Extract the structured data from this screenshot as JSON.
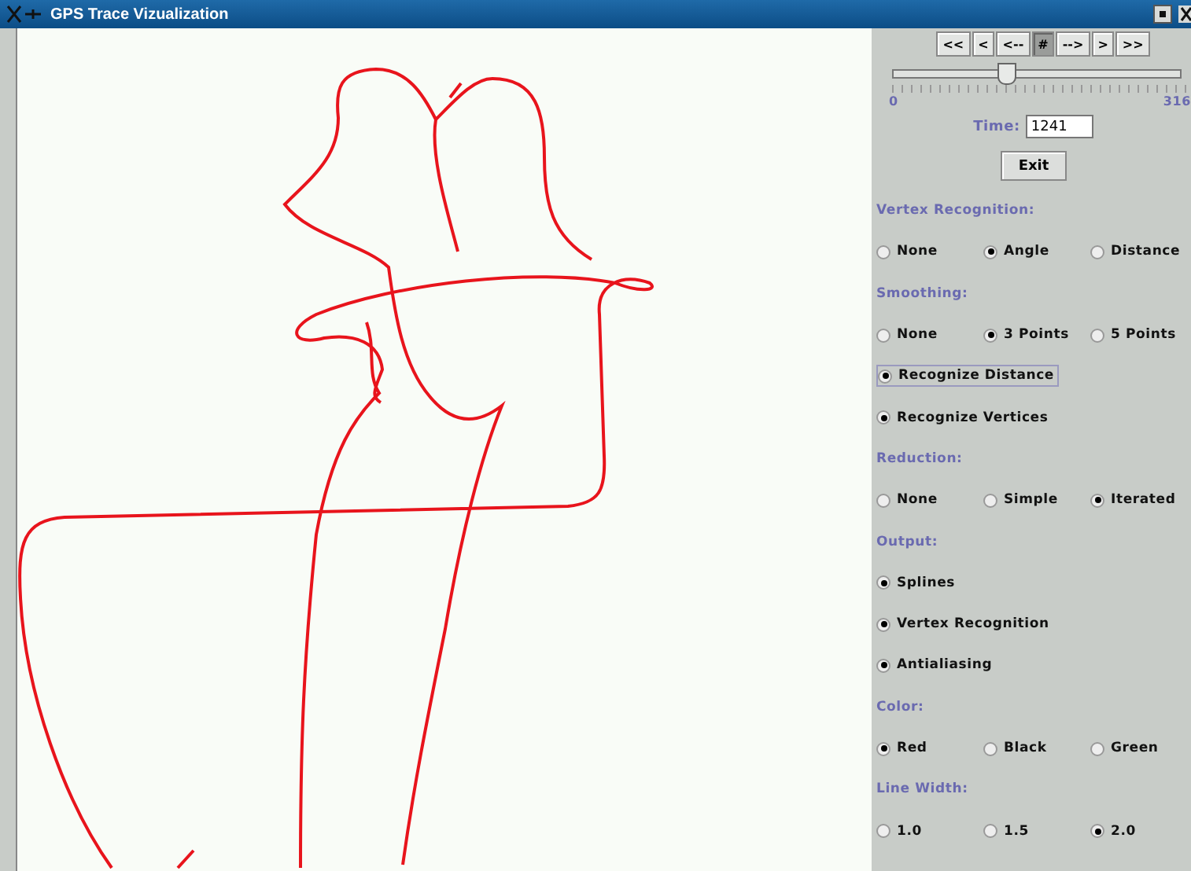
{
  "window": {
    "title": "GPS Trace Vizualization"
  },
  "nav_buttons": [
    {
      "label": "<<",
      "selected": false
    },
    {
      "label": "<",
      "selected": false
    },
    {
      "label": "<--",
      "selected": false
    },
    {
      "label": "#",
      "selected": true
    },
    {
      "label": "-->",
      "selected": false
    },
    {
      "label": ">",
      "selected": false
    },
    {
      "label": ">>",
      "selected": false
    }
  ],
  "time_slider": {
    "level": 0.39,
    "min_label": "0",
    "max_label": "316"
  },
  "time_field": {
    "label": "Time:",
    "value": "1241"
  },
  "exit_button": {
    "label": "Exit"
  },
  "sections": [
    {
      "title": "Vertex Recognition:",
      "rows": [
        {
          "kind": "choice",
          "options": [
            {
              "label": "None",
              "selected": false
            },
            {
              "label": "Angle",
              "selected": true
            },
            {
              "label": "Distance",
              "selected": false
            }
          ]
        }
      ]
    },
    {
      "title": "Smoothing:",
      "rows": [
        {
          "kind": "choice",
          "options": [
            {
              "label": "None",
              "selected": false
            },
            {
              "label": "3 Points",
              "selected": true
            },
            {
              "label": "5 Points",
              "selected": false
            }
          ]
        },
        {
          "kind": "toggle",
          "label": "Recognize Distance",
          "checked": true,
          "focused": true
        },
        {
          "kind": "toggle",
          "label": "Recognize Vertices",
          "checked": true,
          "focused": false
        }
      ]
    },
    {
      "title": "Reduction:",
      "rows": [
        {
          "kind": "choice",
          "options": [
            {
              "label": "None",
              "selected": false
            },
            {
              "label": "Simple",
              "selected": false
            },
            {
              "label": "Iterated",
              "selected": true
            }
          ]
        }
      ]
    },
    {
      "title": "Output:",
      "rows": [
        {
          "kind": "toggle",
          "label": "Splines",
          "checked": true,
          "focused": false
        },
        {
          "kind": "toggle",
          "label": "Vertex Recognition",
          "checked": true,
          "focused": false
        },
        {
          "kind": "toggle",
          "label": "Antialiasing",
          "checked": true,
          "focused": false
        }
      ]
    },
    {
      "title": "Color:",
      "rows": [
        {
          "kind": "choice",
          "options": [
            {
              "label": "Red",
              "selected": true
            },
            {
              "label": "Black",
              "selected": false
            },
            {
              "label": "Green",
              "selected": false
            }
          ]
        }
      ]
    },
    {
      "title": "Line Width:",
      "rows": [
        {
          "kind": "choice",
          "options": [
            {
              "label": "1.0",
              "selected": false
            },
            {
              "label": "1.5",
              "selected": false
            },
            {
              "label": "2.0",
              "selected": true
            }
          ]
        }
      ]
    }
  ]
}
